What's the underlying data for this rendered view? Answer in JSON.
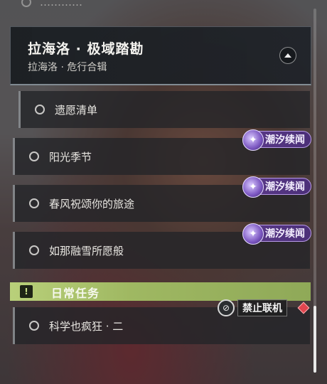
{
  "top_item": {
    "label": "…………"
  },
  "chapter": {
    "title": "拉海洛 · 极域踏勘",
    "subtitle": "拉海洛 · 危行合辑"
  },
  "quests": [
    {
      "label": "遗愿清单"
    },
    {
      "label": "阳光季节",
      "badge": "潮汐续闻"
    },
    {
      "label": "春风祝颂你的旅途",
      "badge": "潮汐续闻"
    },
    {
      "label": "如那融雪所愿般",
      "badge": "潮汐续闻"
    }
  ],
  "daily": {
    "title": "日常任务",
    "icon_text": "!",
    "multiplayer_label": "禁止联机",
    "quests": [
      {
        "label": "科学也疯狂 · 二"
      }
    ]
  },
  "colors": {
    "badge_purple": "#5b3a8a",
    "daily_green": "#a9c36b",
    "alert_red": "#e0464f"
  }
}
